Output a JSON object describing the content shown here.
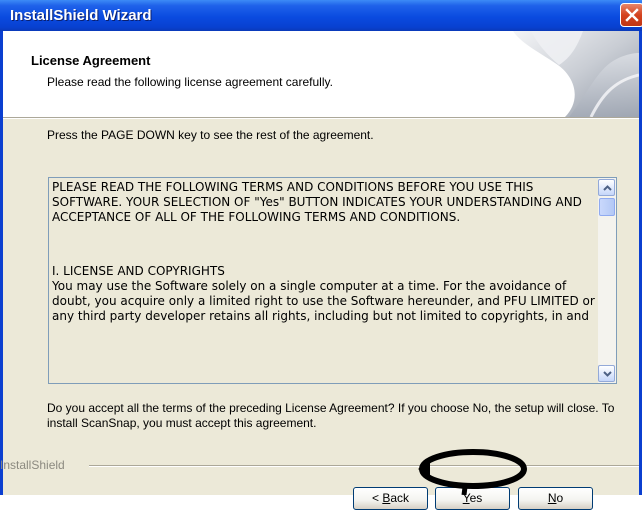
{
  "window": {
    "title": "InstallShield Wizard"
  },
  "header": {
    "title": "License Agreement",
    "subtitle": "Please read the following license agreement carefully."
  },
  "instruction": "Press the PAGE DOWN key to see the rest of the agreement.",
  "license": {
    "paragraph1": "PLEASE READ THE FOLLOWING TERMS AND CONDITIONS BEFORE YOU USE THIS SOFTWARE. YOUR SELECTION OF \"Yes\" BUTTON INDICATES YOUR UNDERSTANDING AND ACCEPTANCE OF ALL OF THE FOLLOWING TERMS AND CONDITIONS.",
    "heading": "I. LICENSE AND COPYRIGHTS",
    "paragraph2": " You may use the Software solely on a single computer at a time. For the avoidance of doubt, you acquire only a limited right to use the Software hereunder, and PFU LIMITED or any third party developer retains all rights, including but not limited to copyrights, in and"
  },
  "question": "Do you accept all the terms of the preceding License Agreement?  If you choose No,  the setup will close.  To install ScanSnap, you must accept this agreement.",
  "footer": {
    "group_label": "InstallShield"
  },
  "buttons": {
    "back_mnemonic": "B",
    "back_rest": "ack",
    "back_prefix": "< ",
    "yes_mnemonic": "Y",
    "yes_rest": "es",
    "no_mnemonic": "N",
    "no_rest": "o"
  },
  "icons": {
    "close": "close-icon",
    "scroll_up": "chevron-up-icon",
    "scroll_down": "chevron-down-icon"
  },
  "colors": {
    "titlebar": "#0a4be0",
    "dialog_face": "#ece9d8",
    "annotation": "#000000"
  }
}
